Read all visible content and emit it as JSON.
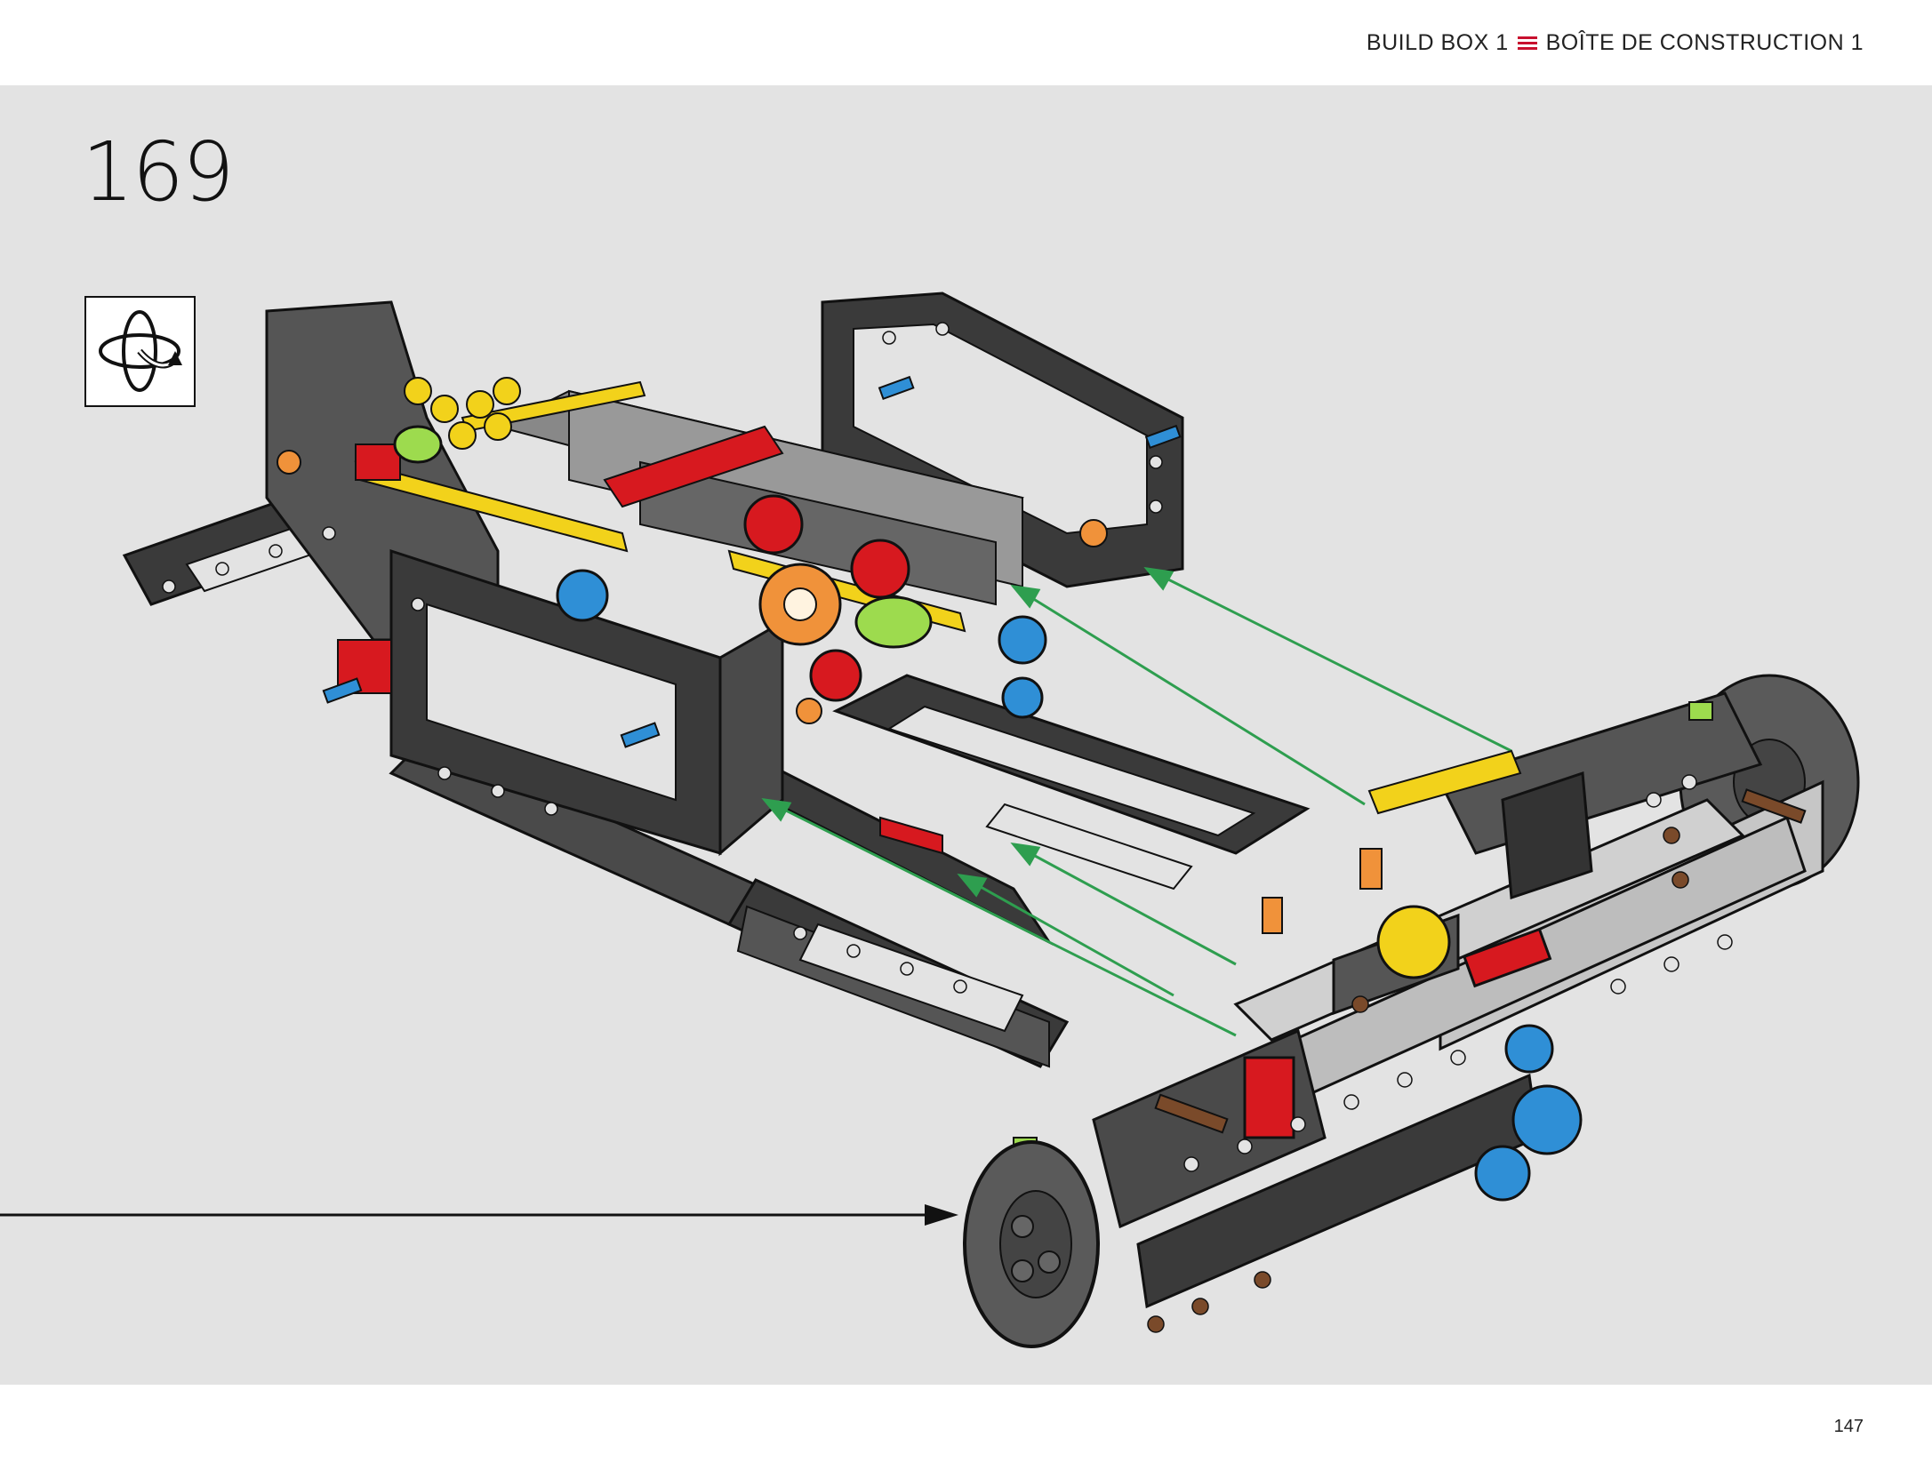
{
  "header": {
    "build_box_en": "BUILD BOX 1",
    "build_box_fr": "BOÎTE DE CONSTRUCTION 1"
  },
  "step": {
    "number": "169"
  },
  "icons": {
    "rotate": "rotate-model-icon"
  },
  "footer": {
    "page_number": "147"
  },
  "colors": {
    "background": "#e3e3e3",
    "accent": "#c8102e",
    "guide_arrow": "#2e9e4f"
  }
}
